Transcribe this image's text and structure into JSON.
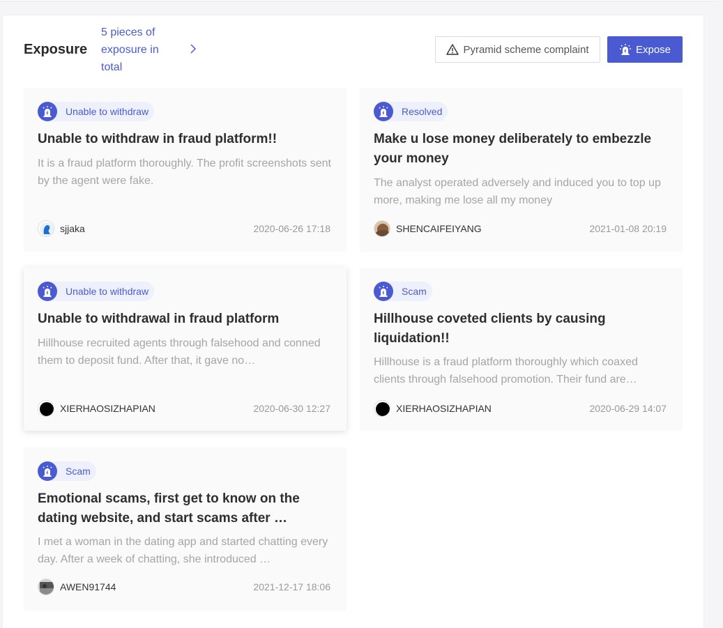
{
  "header": {
    "title": "Exposure",
    "count_text": "5 pieces of exposure in total",
    "complaint_button": "Pyramid scheme complaint",
    "expose_button": "Expose"
  },
  "colors": {
    "accent": "#4a5bd1",
    "badge_bg": "#eef0fb",
    "card_bg": "#fafafa"
  },
  "cards": [
    {
      "tag": "Unable to withdraw",
      "title": "Unable to withdraw in fraud platform!!",
      "description": "It is a fraud platform thoroughly. The profit screenshots sent by the agent were fake.",
      "user": "sjjaka",
      "time": "2020-06-26 17:18",
      "avatar": "blue-silhouette"
    },
    {
      "tag": "Resolved",
      "title": "Make u lose money deliberately to embezzle your money",
      "description": "The analyst operated adversely and induced you to top up more, making me lose all my money",
      "user": "SHENCAIFEIYANG",
      "time": "2021-01-08 20:19",
      "avatar": "photo-brown"
    },
    {
      "tag": "Unable to withdraw",
      "title": "Unable to withdrawal in fraud platform",
      "description": "Hillhouse recruited agents through falsehood and conned them to deposit fund. After that, it gave no…",
      "user": "XIERHAOSIZHAPIAN",
      "time": "2020-06-30 12:27",
      "avatar": "black-circle"
    },
    {
      "tag": "Scam",
      "title": "Hillhouse coveted clients by causing liquidation!!",
      "description": "Hillhouse is a fraud platform thoroughly which coaxed clients through falsehood promotion. Their fund are…",
      "user": "XIERHAOSIZHAPIAN",
      "time": "2020-06-29 14:07",
      "avatar": "black-circle"
    },
    {
      "tag": "Scam",
      "title": "Emotional scams, first get to know on the dating website, and start scams after …",
      "description": "I met a woman in the dating app and started chatting every day. After a week of chatting, she introduced …",
      "user": "AWEN91744",
      "time": "2021-12-17 18:06",
      "avatar": "photo-gray"
    }
  ]
}
